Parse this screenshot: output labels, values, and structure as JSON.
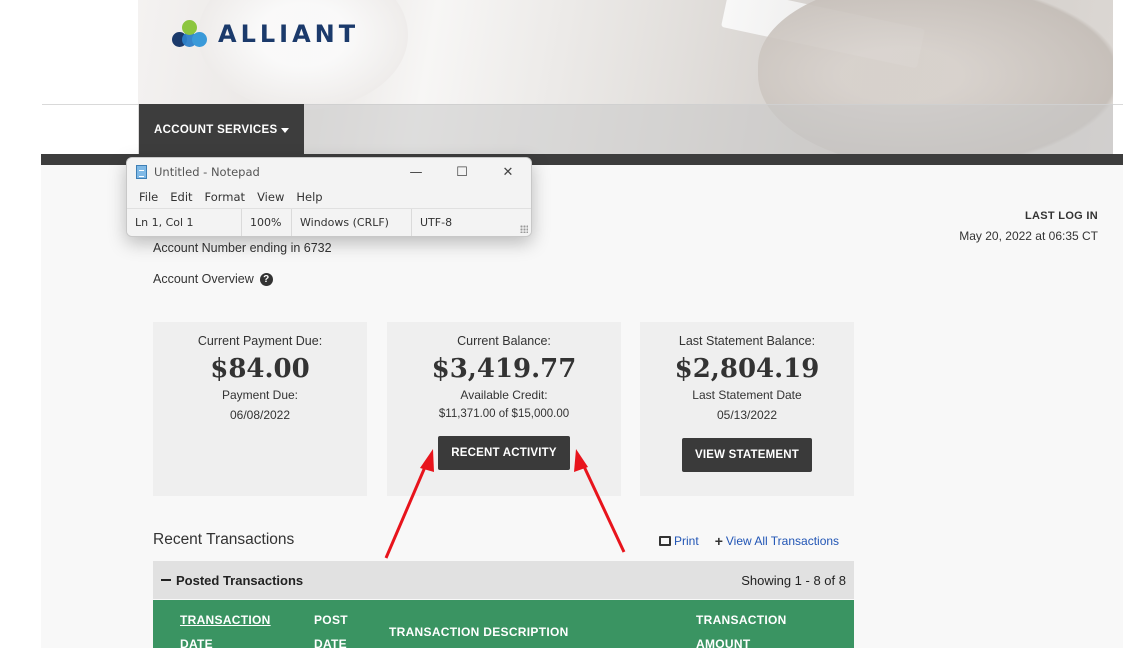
{
  "brand": {
    "name": "ALLIANT"
  },
  "nav": {
    "account_services": "ACCOUNT SERVICES"
  },
  "account": {
    "number_text": "Account Number ending in 6732",
    "overview_label": "Account Overview"
  },
  "last_login": {
    "label": "LAST LOG IN",
    "value": "May 20, 2022 at 06:35 CT"
  },
  "cards": [
    {
      "title": "Current Payment Due:",
      "amount": "$84.00",
      "sub": "Payment Due:",
      "sub2": "06/08/2022"
    },
    {
      "title": "Current Balance:",
      "amount": "$3,419.77",
      "sub": "Available Credit:",
      "sub2": "$11,371.00 of $15,000.00",
      "button": "RECENT ACTIVITY"
    },
    {
      "title": "Last Statement Balance:",
      "amount": "$2,804.19",
      "sub": "Last Statement Date",
      "sub2": "05/13/2022",
      "button": "VIEW STATEMENT"
    }
  ],
  "transactions": {
    "title": "Recent Transactions",
    "print": "Print",
    "view_all": "View All Transactions",
    "posted_label": "Posted Transactions",
    "showing": "Showing 1 - 8 of 8",
    "headers": {
      "transaction_date_1": "TRANSACTION",
      "transaction_date_2": "DATE",
      "post_date_1": "POST",
      "post_date_2": "DATE",
      "description": "TRANSACTION DESCRIPTION",
      "amount_1": "TRANSACTION",
      "amount_2": "AMOUNT"
    }
  },
  "notepad": {
    "title": "Untitled - Notepad",
    "menu": [
      "File",
      "Edit",
      "Format",
      "View",
      "Help"
    ],
    "status": {
      "position": "Ln 1, Col 1",
      "zoom": "100%",
      "line_ending": "Windows (CRLF)",
      "encoding": "UTF-8"
    }
  },
  "colors": {
    "header_green": "#3a9462",
    "dark_button": "#3a3a3a",
    "link_blue": "#2155b5",
    "arrow_red": "#e8141c"
  }
}
